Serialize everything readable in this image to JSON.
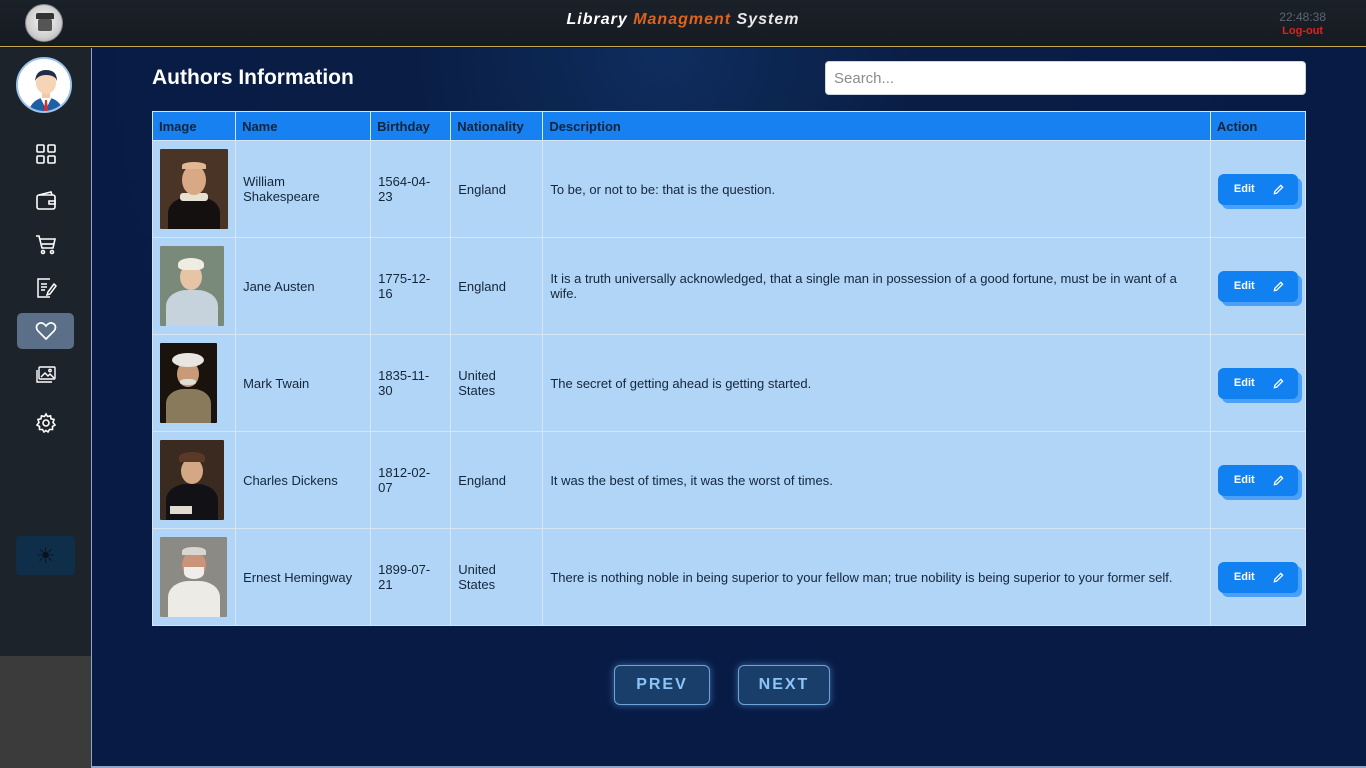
{
  "app": {
    "title_part1": "Library ",
    "title_part2": "Managment",
    "title_part3": " System",
    "clock": "22:48:38",
    "logout_label": "Log-out"
  },
  "sidebar": {
    "items": [
      {
        "name": "dashboard",
        "icon": "grid-icon",
        "active": false
      },
      {
        "name": "wallet",
        "icon": "wallet-icon",
        "active": false
      },
      {
        "name": "cart",
        "icon": "cart-icon",
        "active": false
      },
      {
        "name": "notes",
        "icon": "edit-document-icon",
        "active": false
      },
      {
        "name": "favorites",
        "icon": "heart-icon",
        "active": true
      },
      {
        "name": "gallery",
        "icon": "images-icon",
        "active": false
      },
      {
        "name": "settings",
        "icon": "gear-icon",
        "active": false
      }
    ],
    "theme_toggle_icon": "sun-icon"
  },
  "page": {
    "title": "Authors Information",
    "search_placeholder": "Search..."
  },
  "table": {
    "headers": [
      "Image",
      "Name",
      "Birthday",
      "Nationality",
      "Description",
      "Action"
    ],
    "rows": [
      {
        "name": "William Shakespeare",
        "birthday": "1564-04-23",
        "nationality": "England",
        "description": "To be, or not to be: that is the question.",
        "action": "Edit"
      },
      {
        "name": "Jane Austen",
        "birthday": "1775-12-16",
        "nationality": "England",
        "description": "It is a truth universally acknowledged, that a single man in possession of a good fortune, must be in want of a wife.",
        "action": "Edit"
      },
      {
        "name": "Mark Twain",
        "birthday": "1835-11-30",
        "nationality": "United States",
        "description": "The secret of getting ahead is getting started.",
        "action": "Edit"
      },
      {
        "name": "Charles Dickens",
        "birthday": "1812-02-07",
        "nationality": "England",
        "description": "It was the best of times, it was the worst of times.",
        "action": "Edit"
      },
      {
        "name": "Ernest Hemingway",
        "birthday": "1899-07-21",
        "nationality": "United States",
        "description": "There is nothing noble in being superior to your fellow man; true nobility is being superior to your former self.",
        "action": "Edit"
      }
    ]
  },
  "pager": {
    "prev_label": "PREV",
    "next_label": "NEXT"
  },
  "colors": {
    "accent": "#1781f2",
    "title_accent": "#e0621c",
    "logout": "#e1221c",
    "table_bg": "#b1d5f7"
  }
}
